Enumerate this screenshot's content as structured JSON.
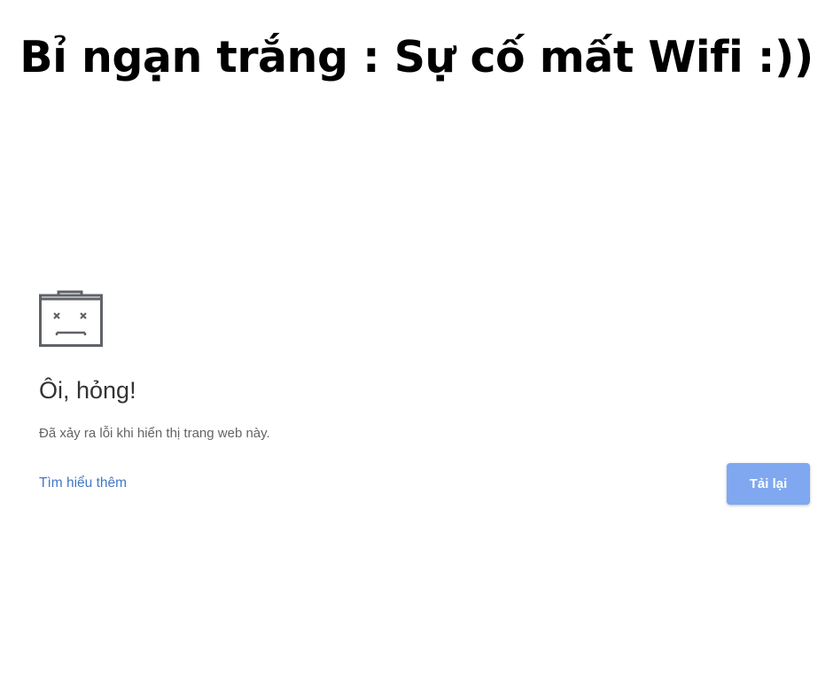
{
  "caption": {
    "text": "Bỉ ngạn trắng : Sự cố mất Wifi :))"
  },
  "error_page": {
    "icon": "sad-tab-icon",
    "heading": "Ôi, hỏng!",
    "message": "Đã xảy ra lỗi khi hiển thị trang web này.",
    "learn_more_label": "Tìm hiểu thêm",
    "reload_label": "Tải lại"
  },
  "colors": {
    "heading": "#333333",
    "message": "#646464",
    "link": "#4277c7",
    "button_bg": "#7fa8f0",
    "button_text": "#ffffff",
    "icon": "#5f6368"
  }
}
